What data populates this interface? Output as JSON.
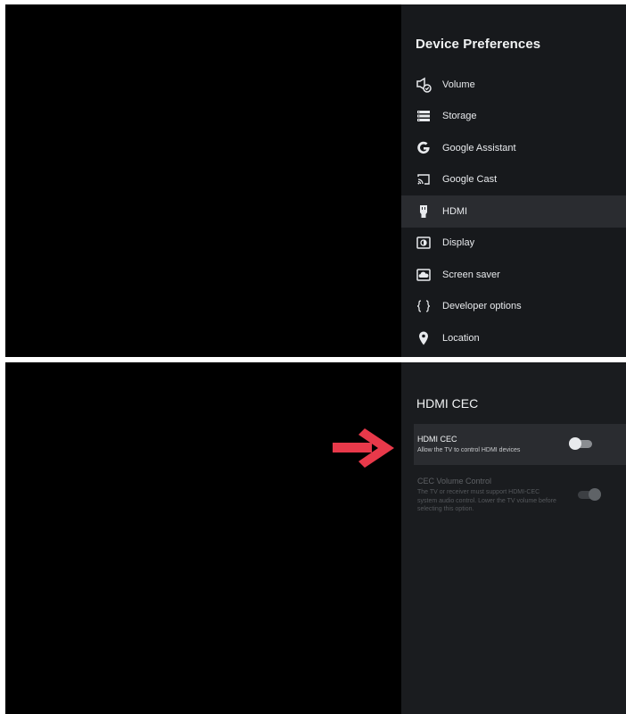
{
  "device_preferences": {
    "title": "Device Preferences",
    "items": [
      {
        "label": "Volume",
        "icon": "volume-icon"
      },
      {
        "label": "Storage",
        "icon": "storage-icon"
      },
      {
        "label": "Google Assistant",
        "icon": "google-icon"
      },
      {
        "label": "Google Cast",
        "icon": "cast-icon"
      },
      {
        "label": "HDMI",
        "icon": "hdmi-icon",
        "focused": true
      },
      {
        "label": "Display",
        "icon": "display-icon"
      },
      {
        "label": "Screen saver",
        "icon": "screen-saver-icon"
      },
      {
        "label": "Developer options",
        "icon": "braces-icon"
      },
      {
        "label": "Location",
        "icon": "location-pin-icon"
      }
    ]
  },
  "hdmi_cec": {
    "title": "HDMI CEC",
    "options": [
      {
        "title": "HDMI CEC",
        "subtitle": "Allow the TV to control HDMI devices",
        "enabled": false,
        "focused": true
      },
      {
        "title": "CEC Volume Control",
        "subtitle": "The TV or receiver must support HDMI-CEC system audio control. Lower the TV volume before selecting this option.",
        "enabled": true,
        "disabled": true
      }
    ]
  },
  "colors": {
    "panel_bg": "#1a1c1f",
    "focus_bg": "#2a2c30",
    "annotation_arrow": "#e8394a"
  }
}
